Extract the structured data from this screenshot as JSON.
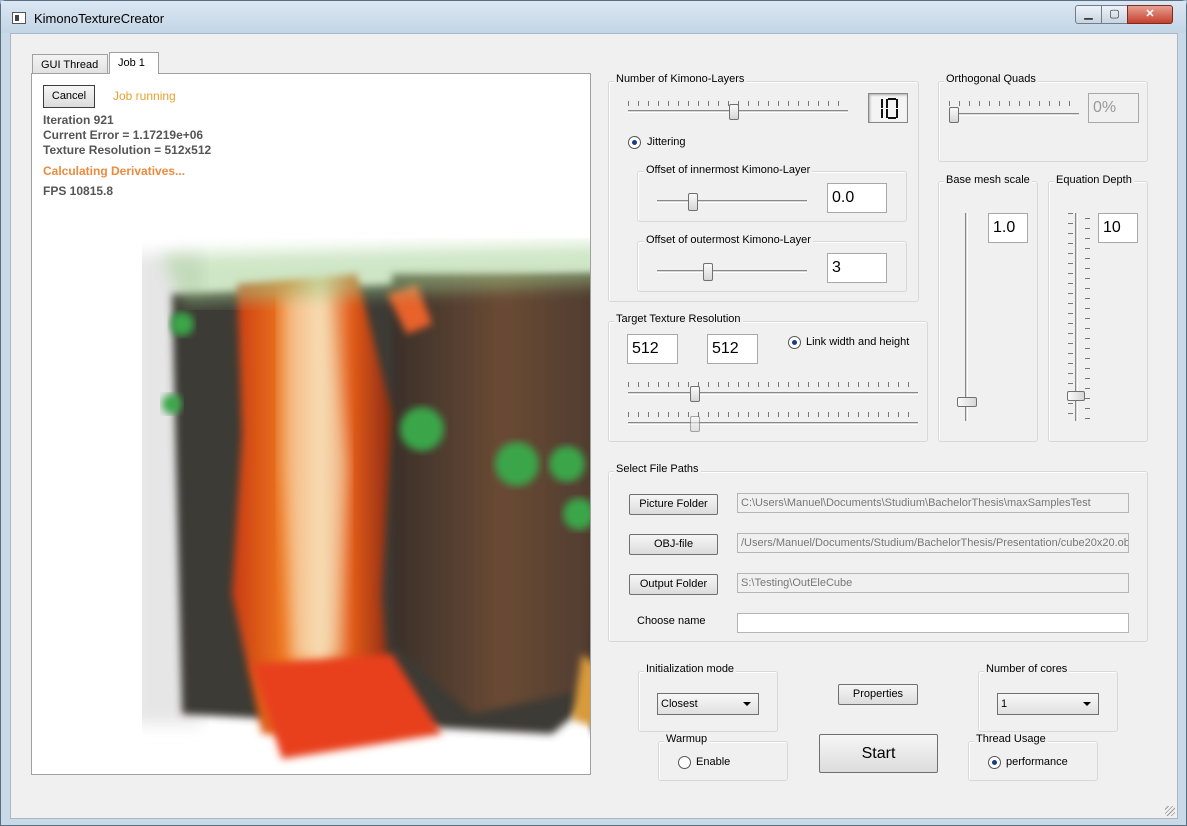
{
  "window": {
    "title": "KimonoTextureCreator",
    "min_label": "▁",
    "max_label": "▢",
    "close_label": "✕"
  },
  "tabs": [
    {
      "label": "GUI Thread"
    },
    {
      "label": "Job 1"
    }
  ],
  "job": {
    "cancel_label": "Cancel",
    "status": "Job running",
    "iteration": "Iteration 921",
    "current_error": "Current Error = 1.17219e+06",
    "texture_resolution": "Texture Resolution = 512x512",
    "phase": "Calculating Derivatives...",
    "fps": "FPS 10815.8"
  },
  "kimono_layers": {
    "title": "Number of Kimono-Layers",
    "value": 10,
    "slider_fraction": 0.48,
    "jittering_label": "Jittering",
    "jittering_checked": true,
    "inner_title": "Offset of innermost Kimono-Layer",
    "inner_value": "0.0",
    "inner_fraction": 0.22,
    "outer_title": "Offset of outermost Kimono-Layer",
    "outer_value": "3",
    "outer_fraction": 0.33
  },
  "orthogonal_quads": {
    "title": "Orthogonal Quads",
    "value": "0%",
    "slider_fraction": 0.0
  },
  "base_mesh_scale": {
    "title": "Base mesh scale",
    "value": "1.0",
    "slider_fraction": 0.07
  },
  "equation_depth": {
    "title": "Equation Depth",
    "value": "10",
    "slider_fraction": 0.1
  },
  "target_resolution": {
    "title": "Target Texture Resolution",
    "width": "512",
    "height": "512",
    "link_label": "Link width and height",
    "link_checked": true,
    "width_fraction": 0.22,
    "height_fraction": 0.22
  },
  "file_paths": {
    "title": "Select File Paths",
    "picture_button": "Picture Folder",
    "picture_path": "C:\\Users\\Manuel\\Documents\\Studium\\BachelorThesis\\maxSamplesTest",
    "obj_button": "OBJ-file",
    "obj_path": "/Users/Manuel/Documents/Studium/BachelorThesis/Presentation/cube20x20.obj",
    "output_button": "Output Folder",
    "output_path": "S:\\Testing\\OutEleCube",
    "name_label": "Choose name",
    "name_value": ""
  },
  "init_mode": {
    "title": "Initialization mode",
    "selected": "Closest"
  },
  "properties_label": "Properties",
  "cores": {
    "title": "Number of cores",
    "selected": "1"
  },
  "warmup": {
    "title": "Warmup",
    "enable_label": "Enable",
    "enabled": false
  },
  "start_label": "Start",
  "thread_usage": {
    "title": "Thread Usage",
    "option_label": "performance",
    "selected": true
  }
}
